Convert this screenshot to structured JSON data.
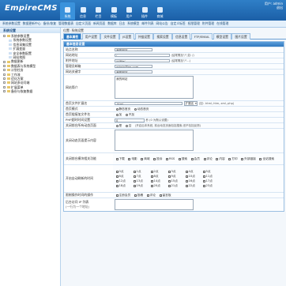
{
  "header": {
    "logo": "EmpireCMS",
    "nav": [
      {
        "label": "系统",
        "active": true
      },
      {
        "label": "信息",
        "active": false
      },
      {
        "label": "栏目",
        "active": false
      },
      {
        "label": "模板",
        "active": false
      },
      {
        "label": "用户",
        "active": false
      },
      {
        "label": "插件",
        "active": false
      },
      {
        "label": "商城",
        "active": false
      }
    ],
    "user_line1": "用户: admin",
    "user_line2": "退出"
  },
  "subbar": [
    "系统参数设置",
    "数据更新中心",
    "备份/恢复",
    "管理数据表",
    "自定义页面",
    "新闻页面",
    "数据库",
    "日志",
    "系统模型",
    "邮件列表",
    "网站公告",
    "自定义标签",
    "权限管理",
    "附件管理",
    "在线管理"
  ],
  "sidebar": {
    "title": "系统设置",
    "items": [
      {
        "label": "系统参数设置",
        "level": 1,
        "type": "folder"
      },
      {
        "label": "系统参数设置",
        "level": 2,
        "type": "page"
      },
      {
        "label": "信息采集设置",
        "level": 2,
        "type": "page"
      },
      {
        "label": "扩展变量",
        "level": 2,
        "type": "page"
      },
      {
        "label": "安全参数配置",
        "level": 2,
        "type": "page"
      },
      {
        "label": "网站地图",
        "level": 2,
        "type": "page"
      },
      {
        "label": "数据更新",
        "level": 1,
        "type": "folder"
      },
      {
        "label": "数据表与系统模型",
        "level": 1,
        "type": "folder"
      },
      {
        "label": "计划任务",
        "level": 1,
        "type": "folder"
      },
      {
        "label": "工作流",
        "level": 1,
        "type": "folder"
      },
      {
        "label": "优化方案",
        "level": 1,
        "type": "folder"
      },
      {
        "label": "网站多访问端",
        "level": 1,
        "type": "folder"
      },
      {
        "label": "扩展菜单",
        "level": 1,
        "type": "folder"
      },
      {
        "label": "备份与恢复数据",
        "level": 1,
        "type": "folder"
      }
    ]
  },
  "main": {
    "breadcrumb": "位置: 系统设置",
    "tabs": [
      {
        "label": "基本属性",
        "active": true
      },
      {
        "label": "用户设置",
        "active": false
      },
      {
        "label": "文件设置",
        "active": false
      },
      {
        "label": "JS设置",
        "active": false
      },
      {
        "label": "外链设置",
        "active": false
      },
      {
        "label": "搜索设置",
        "active": false
      },
      {
        "label": "信息设置",
        "active": false
      },
      {
        "label": "FTP/EMAIL",
        "active": false
      },
      {
        "label": "模型设置",
        "active": false
      },
      {
        "label": "图片设置",
        "active": false
      }
    ],
    "section_title": "基本信息设置",
    "fields": {
      "site_name": {
        "label": "站点名称",
        "value": "我的网站"
      },
      "site_url": {
        "label": "网站地址",
        "value": "/",
        "hint": "(结尾需加\"/\",如: /)"
      },
      "attach_url": {
        "label": "附件地址",
        "value": "/d/file/",
        "hint": "(结尾需加\"/\"...)"
      },
      "email": {
        "label": "管理员邮箱",
        "value": "admin@qq.com"
      },
      "keywords": {
        "label": "网站关键字",
        "value": "我的网站"
      },
      "description": {
        "label": "网站简介",
        "value": "我的网站"
      },
      "index_ext": {
        "label": "首页文件扩展名",
        "value": ".html",
        "select": "扩展名",
        "hint": "(如: .html,.htm,.xml,.php)"
      },
      "index_mode": {
        "label": "首页模式",
        "options": [
          "静态首页",
          "动态首页"
        ],
        "selected": 0
      },
      "index_file": {
        "label": "首页链接加文件名",
        "options": [
          "加",
          "不加"
        ],
        "selected": 1
      },
      "php_timeout": {
        "label": "PHP超时时间设置",
        "value": "0",
        "hint": "秒 (0 为默认设置)"
      },
      "close_dynamic": {
        "label": "关闭前台所有动态页面",
        "options": [
          "是",
          "否"
        ],
        "selected": 1,
        "hint": "(开启后本系统, 前台动态页面包括搜索,但不包括反馈)"
      },
      "close_notice": {
        "label": "关闭动态页面提示内容",
        "value": ""
      },
      "close_module": {
        "label": "关闭前台模块相关功能",
        "options": [
          "下载",
          "电影",
          "商城",
          "投诉",
          "RSS",
          "搜索",
          "会员",
          "评论",
          "内容",
          "打印",
          "外部链接",
          "全站搜索"
        ]
      },
      "update_days_label": "开启自动刷新的时间",
      "update_days": [
        "0点",
        "1点",
        "2点",
        "3点",
        "4点",
        "5点",
        "6点",
        "7点",
        "8点",
        "9点",
        "10点",
        "11点",
        "12点",
        "13点",
        "14点",
        "15点",
        "16点",
        "17点",
        "18点",
        "19点",
        "20点",
        "21点",
        "22点",
        "23点"
      ],
      "limit_time": {
        "label": "限制操作时间的操作",
        "options": [
          "注册会员",
          "投稿",
          "评论",
          "留言板"
        ]
      },
      "forbid_ip": {
        "label": "后台访问 IP 列表",
        "sub": "(一行为一个地址)",
        "value": ""
      }
    }
  }
}
